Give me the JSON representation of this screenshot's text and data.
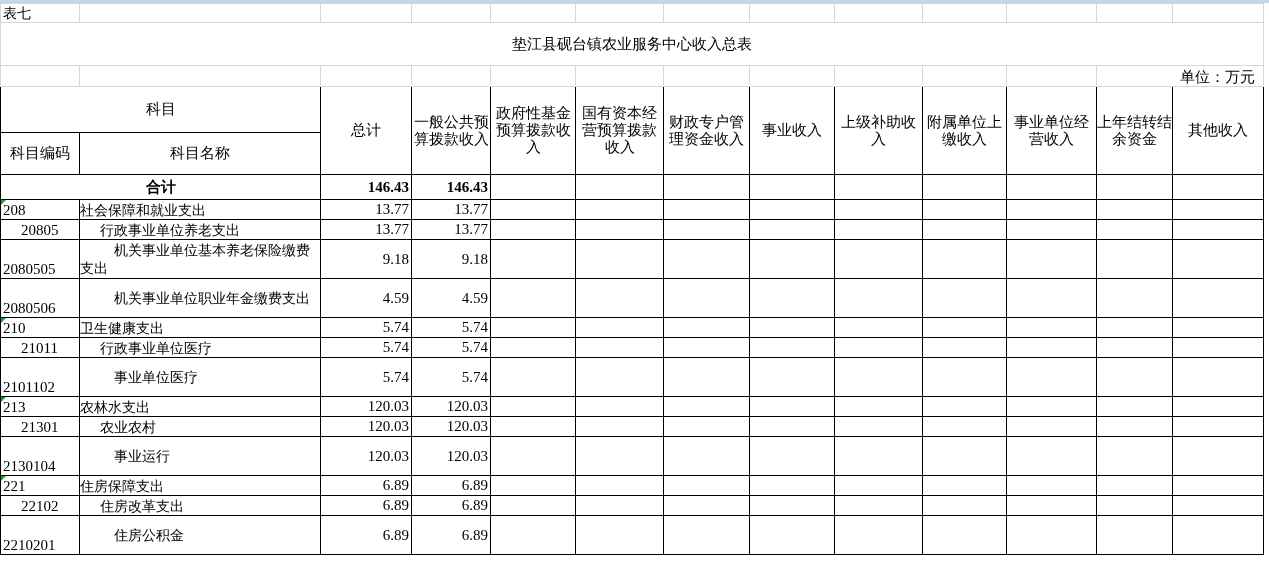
{
  "sheet_label": "表七",
  "title": "垫江县砚台镇农业服务中心收入总表",
  "unit": "单位：万元",
  "table": {
    "group_header": "科目",
    "columns": [
      "科目编码",
      "科目名称",
      "总计",
      "一般公共预算拨款收入",
      "政府性基金预算拨款收入",
      "国有资本经营预算拨款收入",
      "财政专户管理资金收入",
      "事业收入",
      "上级补助收入",
      "附属单位上缴收入",
      "事业单位经营收入",
      "上年结转结余资金",
      "其他收入"
    ],
    "total_row": {
      "label": "合计",
      "values": [
        "146.43",
        "146.43"
      ]
    },
    "rows": [
      {
        "code": "208",
        "name": "社会保障和就业支出",
        "values": [
          "13.77",
          "13.77"
        ],
        "flagged": true,
        "children": [
          {
            "code": "20805",
            "name": "行政事业单位养老支出",
            "values": [
              "13.77",
              "13.77"
            ],
            "flagged": false,
            "children": [
              {
                "code": "2080505",
                "name": "机关事业单位基本养老保险缴费支出",
                "values": [
                  "9.18",
                  "9.18"
                ],
                "flagged": false
              },
              {
                "code": "2080506",
                "name": "机关事业单位职业年金缴费支出",
                "values": [
                  "4.59",
                  "4.59"
                ],
                "flagged": false
              }
            ]
          }
        ]
      },
      {
        "code": "210",
        "name": "卫生健康支出",
        "values": [
          "5.74",
          "5.74"
        ],
        "flagged": true,
        "children": [
          {
            "code": "21011",
            "name": "行政事业单位医疗",
            "values": [
              "5.74",
              "5.74"
            ],
            "flagged": false,
            "children": [
              {
                "code": "2101102",
                "name": "事业单位医疗",
                "values": [
                  "5.74",
                  "5.74"
                ],
                "flagged": false
              }
            ]
          }
        ]
      },
      {
        "code": "213",
        "name": "农林水支出",
        "values": [
          "120.03",
          "120.03"
        ],
        "flagged": true,
        "children": [
          {
            "code": "21301",
            "name": "农业农村",
            "values": [
              "120.03",
              "120.03"
            ],
            "flagged": false,
            "children": [
              {
                "code": "2130104",
                "name": "事业运行",
                "values": [
                  "120.03",
                  "120.03"
                ],
                "flagged": false
              }
            ]
          }
        ]
      },
      {
        "code": "221",
        "name": "住房保障支出",
        "values": [
          "6.89",
          "6.89"
        ],
        "flagged": true,
        "children": [
          {
            "code": "22102",
            "name": "住房改革支出",
            "values": [
              "6.89",
              "6.89"
            ],
            "flagged": false,
            "children": [
              {
                "code": "2210201",
                "name": "住房公积金",
                "values": [
                  "6.89",
                  "6.89"
                ],
                "flagged": false
              }
            ]
          }
        ]
      }
    ]
  }
}
